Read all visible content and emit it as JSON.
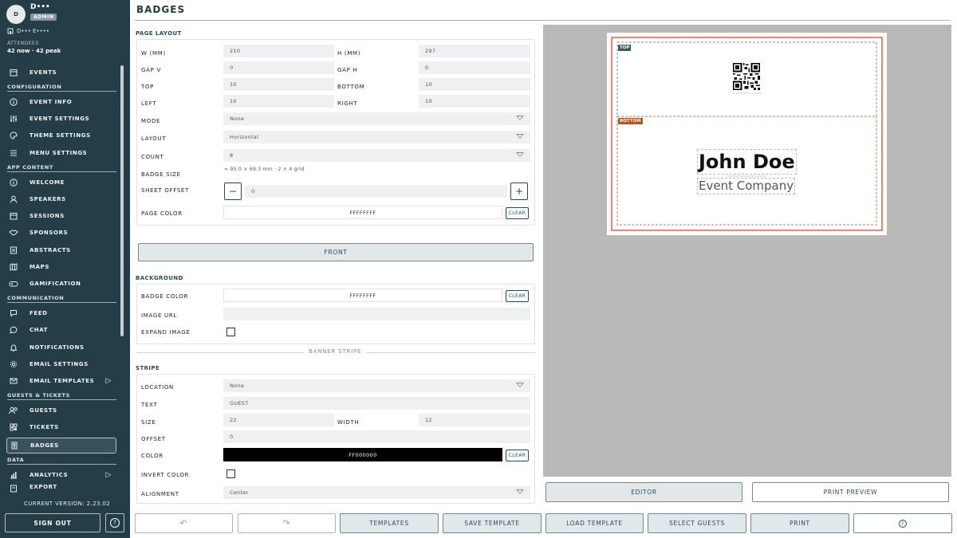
{
  "user": {
    "initial": "D",
    "name": "D•••",
    "role": "ADMIN",
    "org": "D••• E••••"
  },
  "attendees": {
    "label": "ATTENDEES",
    "value": "42 now · 42 peak"
  },
  "nav": {
    "events": "EVENTS",
    "sec_configuration": "CONFIGURATION",
    "event_info": "EVENT INFO",
    "event_settings": "EVENT SETTINGS",
    "theme_settings": "THEME SETTINGS",
    "menu_settings": "MENU SETTINGS",
    "sec_app_content": "APP CONTENT",
    "welcome": "WELCOME",
    "speakers": "SPEAKERS",
    "sessions": "SESSIONS",
    "sponsors": "SPONSORS",
    "abstracts": "ABSTRACTS",
    "maps": "MAPS",
    "gamification": "GAMIFICATION",
    "sec_communication": "COMMUNICATION",
    "feed": "FEED",
    "chat": "CHAT",
    "notifications": "NOTIFICATIONS",
    "email_settings": "EMAIL SETTINGS",
    "email_templates": "EMAIL TEMPLATES",
    "sec_guests_tickets": "GUESTS & TICKETS",
    "guests": "GUESTS",
    "tickets": "TICKETS",
    "badges": "BADGES",
    "sec_data": "DATA",
    "analytics": "ANALYTICS",
    "export": "EXPORT"
  },
  "version": "CURRENT VERSION: 2.23.02",
  "sign_out": "SIGN OUT",
  "page_title": "BADGES",
  "page_layout": {
    "heading": "PAGE LAYOUT",
    "w_label": "W (MM)",
    "w": "210",
    "h_label": "H (MM)",
    "h": "297",
    "gapv_label": "GAP V",
    "gapv": "0",
    "gaph_label": "GAP H",
    "gaph": "0",
    "top_label": "TOP",
    "top": "10",
    "bottom_label": "BOTTOM",
    "bottom": "10",
    "left_label": "LEFT",
    "left": "10",
    "right_label": "RIGHT",
    "right": "10",
    "mode_label": "MODE",
    "mode": "None",
    "layout_label": "LAYOUT",
    "layout": "Horizontal",
    "count_label": "COUNT",
    "count": "8",
    "badge_size_label": "BADGE SIZE",
    "badge_size": "≈ 95.0 × 69.3 mm · 2 × 4 grid",
    "sheet_offset_label": "SHEET OFFSET",
    "sheet_offset": "0",
    "page_color_label": "PAGE COLOR",
    "page_color": "FFFFFFFF",
    "clear": "CLEAR"
  },
  "front_button": "FRONT",
  "background": {
    "heading": "BACKGROUND",
    "badge_color_label": "BADGE COLOR",
    "badge_color": "FFFFFFFF",
    "image_url_label": "IMAGE URL",
    "image_url": "",
    "expand_image_label": "EXPAND IMAGE",
    "clear": "CLEAR"
  },
  "divider_label": "BANNER STRIPE",
  "stripe": {
    "heading": "STRIPE",
    "location_label": "LOCATION",
    "location": "None",
    "text_label": "TEXT",
    "text": "GUEST",
    "size_label": "SIZE",
    "size": "22",
    "width_label": "WIDTH",
    "width": "12",
    "offset_label": "OFFSET",
    "offset": "0",
    "color_label": "COLOR",
    "color": "FF000000",
    "invert_label": "INVERT COLOR",
    "alignment_label": "ALIGNMENT",
    "alignment": "Center",
    "clear": "CLEAR"
  },
  "preview": {
    "top_tag": "TOP",
    "bottom_tag": "BOTTOM",
    "name": "John Doe",
    "company": "Event Company",
    "editor": "EDITOR",
    "print_preview": "PRINT PREVIEW",
    "colors": {
      "accent_red": "#e0614f",
      "top_tag": "#3c5a66",
      "bottom_tag": "#b8551e",
      "stripe_black": "#000000"
    }
  },
  "toolbar": {
    "templates": "TEMPLATES",
    "save_template": "SAVE TEMPLATE",
    "load_template": "LOAD TEMPLATE",
    "select_guests": "SELECT GUESTS",
    "print": "PRINT"
  },
  "icons": [
    "undo-icon",
    "redo-icon",
    "help-icon",
    "calendar-icon",
    "info-icon",
    "sliders-icon",
    "palette-icon",
    "menu-icon",
    "user-icon",
    "handshake-icon",
    "document-icon",
    "map-icon",
    "gamepad-icon",
    "feed-icon",
    "chat-icon",
    "bell-icon",
    "gear-icon",
    "mail-icon",
    "users-icon",
    "ticket-icon",
    "badge-icon",
    "chart-icon",
    "export-icon"
  ]
}
